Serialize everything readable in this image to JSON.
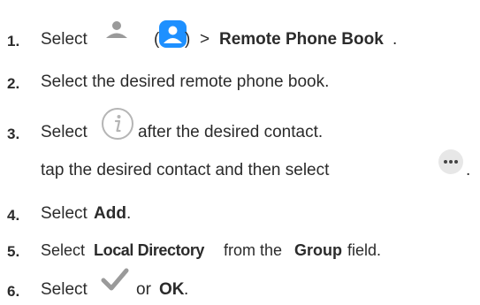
{
  "steps": [
    {
      "num": "1.",
      "text_before": "Select",
      "paren_open": "(",
      "paren_close": ")",
      "arrow": ">",
      "bold": "Remote Phone Book",
      "end": "."
    },
    {
      "num": "2.",
      "text": "Select the desired remote phone book."
    },
    {
      "num": "3.",
      "text_before": "Select",
      "text_after": "after the desired contact.",
      "line2": "tap the desired contact and then select",
      "line2_end": "."
    },
    {
      "num": "4.",
      "text_before": "Select",
      "bold": "Add",
      "end": "."
    },
    {
      "num": "5.",
      "text_before": "Select",
      "bold1": "Local Directory",
      "mid": "from the",
      "bold2": "Group",
      "end": "field."
    },
    {
      "num": "6.",
      "text_before": "Select",
      "mid": "or",
      "bold": "OK",
      "end": "."
    }
  ],
  "icons": {
    "contact_gray": "person-gray-icon",
    "contact_blue": "contact-blue-icon",
    "info": "info-icon",
    "more": "more-icon",
    "check": "checkmark-icon"
  },
  "colors": {
    "blue": "#1e90ff",
    "gray": "#9a9a9a",
    "text": "#2b2b2b"
  }
}
